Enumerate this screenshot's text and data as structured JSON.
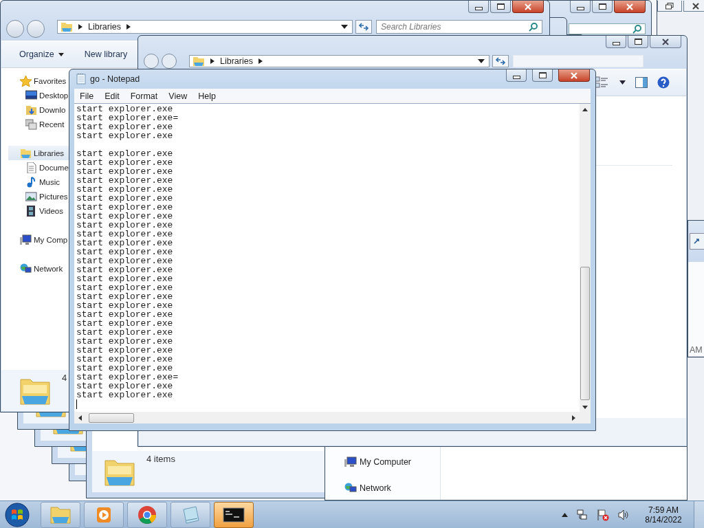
{
  "explorer_front": {
    "address": [
      "Libraries"
    ],
    "search": {
      "placeholder": "Search Libraries"
    },
    "toolbar": [
      {
        "label": "Organize",
        "kind": "menu"
      },
      {
        "label": "New library",
        "kind": "button"
      }
    ],
    "nav": [
      {
        "label": "Favorites",
        "kind": "favorites",
        "selected": false,
        "children": [
          {
            "label": "Desktop",
            "kind": "desktop",
            "selected": false
          },
          {
            "label": "Downlo",
            "kind": "downloads",
            "selected": false
          },
          {
            "label": "Recent",
            "kind": "recent",
            "selected": false
          }
        ]
      },
      {
        "label": "Libraries",
        "kind": "libraries",
        "selected": true,
        "children": [
          {
            "label": "Docume",
            "kind": "documents",
            "selected": false
          },
          {
            "label": "Music",
            "kind": "music",
            "selected": false
          },
          {
            "label": "Pictures",
            "kind": "pictures",
            "selected": false
          },
          {
            "label": "Videos",
            "kind": "videos",
            "selected": false
          }
        ]
      },
      {
        "label": "My Comp",
        "kind": "computer",
        "selected": false
      },
      {
        "label": "Network",
        "kind": "network",
        "selected": false
      }
    ],
    "status": "4"
  },
  "explorer_middle": {
    "address": [
      "Libraries"
    ]
  },
  "explorer_lower": {
    "status": "4 items"
  },
  "explorer_right": {
    "nav": [
      {
        "label": "My Computer",
        "kind": "computer"
      },
      {
        "label": "Network",
        "kind": "network"
      }
    ]
  },
  "explorer_edge": {
    "text": "AM"
  },
  "notepad": {
    "title": "go - Notepad",
    "menu": [
      "File",
      "Edit",
      "Format",
      "View",
      "Help"
    ],
    "text": "start explorer.exe\nstart explorer.exe=\nstart explorer.exe\nstart explorer.exe\n\nstart explorer.exe\nstart explorer.exe\nstart explorer.exe\nstart explorer.exe\nstart explorer.exe\nstart explorer.exe\nstart explorer.exe\nstart explorer.exe\nstart explorer.exe\nstart explorer.exe\nstart explorer.exe\nstart explorer.exe\nstart explorer.exe\nstart explorer.exe\nstart explorer.exe\nstart explorer.exe\nstart explorer.exe\nstart explorer.exe\nstart explorer.exe\nstart explorer.exe\nstart explorer.exe\nstart explorer.exe\nstart explorer.exe\nstart explorer.exe\nstart explorer.exe\nstart explorer.exe=\nstart explorer.exe\nstart explorer.exe"
  },
  "taskbar": {
    "items": [
      {
        "kind": "explorer",
        "selected": false
      },
      {
        "kind": "media",
        "selected": false
      },
      {
        "kind": "browser",
        "selected": false
      },
      {
        "kind": "notepad",
        "selected": false
      },
      {
        "kind": "console",
        "selected": true
      }
    ],
    "clock": {
      "time": "7:59 AM",
      "date": "8/14/2022"
    }
  }
}
